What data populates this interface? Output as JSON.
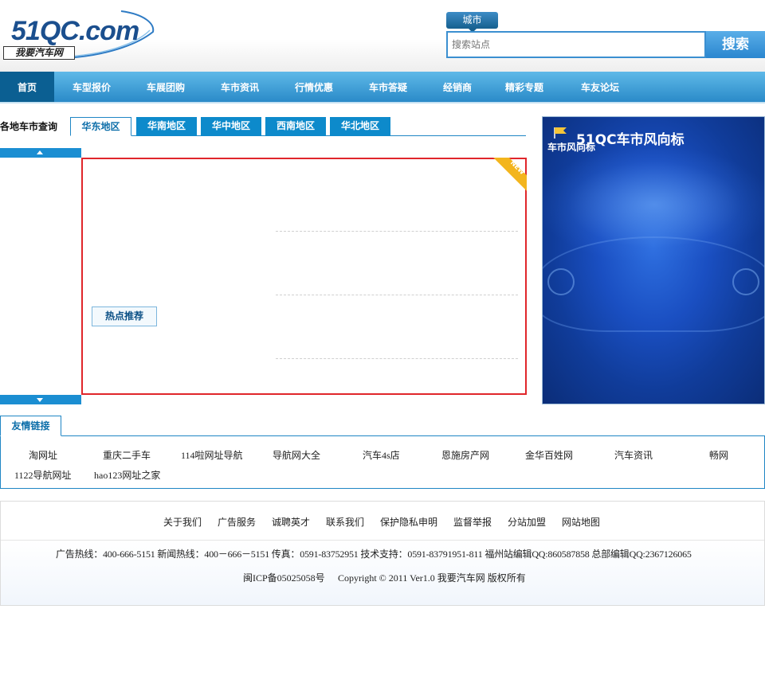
{
  "header": {
    "logo_text": "51QC.com",
    "logo_subtitle": "我要汽车网",
    "city_label": "城市",
    "search_placeholder": "搜索站点",
    "search_button": "搜索"
  },
  "nav": {
    "items": [
      {
        "label": "首页",
        "active": true
      },
      {
        "label": "车型报价"
      },
      {
        "label": "车展团购"
      },
      {
        "label": "车市资讯"
      },
      {
        "label": "行情优惠"
      },
      {
        "label": "车市答疑"
      },
      {
        "label": "经销商"
      },
      {
        "label": "精彩专题"
      },
      {
        "label": "车友论坛"
      }
    ]
  },
  "regions": {
    "title": "各地车市查询",
    "tabs": [
      "华东地区",
      "华南地区",
      "华中地区",
      "西南地区",
      "华北地区"
    ]
  },
  "main": {
    "new_badge": "NEW",
    "hot_tag": "热点推荐"
  },
  "banner": {
    "title": "51QC车市风向标",
    "subtitle": "车市风向标"
  },
  "links": {
    "title": "友情链接",
    "items": [
      "淘网址",
      "重庆二手车",
      "114啦网址导航",
      "导航网大全",
      "汽车4s店",
      "恩施房产网",
      "金华百姓网",
      "汽车资讯",
      "畅网",
      "1122导航网址",
      "hao123网址之家"
    ]
  },
  "footer": {
    "links": [
      "关于我们",
      "广告服务",
      "诚聘英才",
      "联系我们",
      "保护隐私申明",
      "监督举报",
      "分站加盟",
      "网站地图"
    ],
    "contact": "广告热线：400-666-5151 新闻热线：400－666－5151 传真：0591-83752951 技术支持：0591-83791951-811 福州站编辑QQ:860587858 总部编辑QQ:2367126065",
    "icp": "闽ICP备05025058号",
    "copyright": "Copyright © 2011 Ver1.0 我要汽车网  版权所有"
  }
}
